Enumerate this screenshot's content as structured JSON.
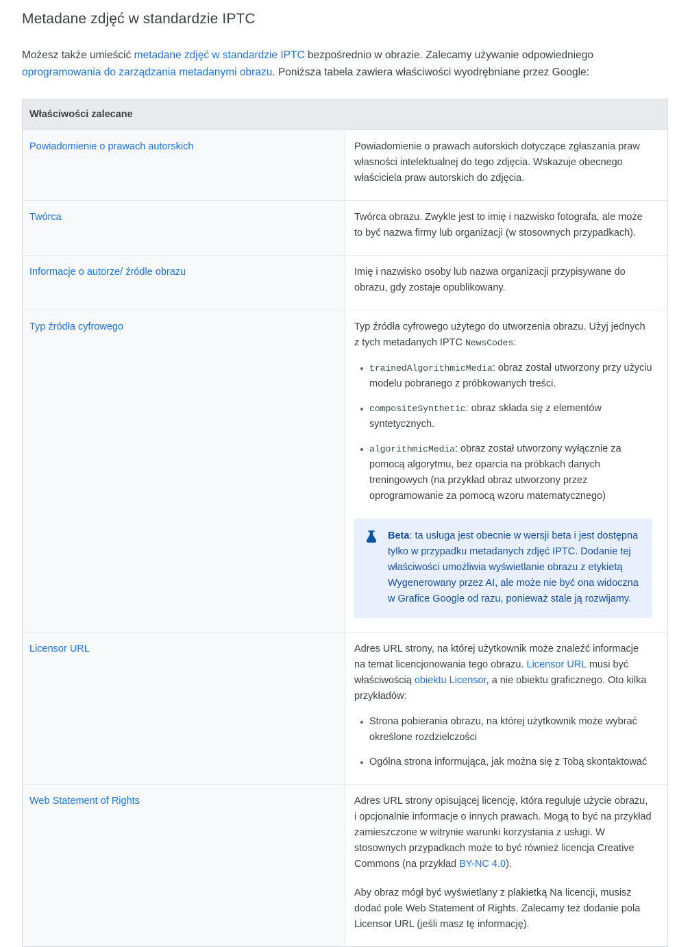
{
  "section": {
    "title": "Metadane zdjęć w standardzie IPTC",
    "intro": {
      "part1": "Możesz także umieścić ",
      "link1": "metadane zdjęć w standardzie IPTC",
      "part2": " bezpośrednio w obrazie. Zalecamy używanie odpowiedniego ",
      "link2": "oprogramowania do zarządzania metadanymi obrazu",
      "part3": ". Poniższa tabela zawiera właściwości wyodrębniane przez Google:"
    }
  },
  "table": {
    "header": "Właściwości zalecane",
    "rows": [
      {
        "name": "Powiadomienie o prawach autorskich",
        "desc": "Powiadomienie o prawach autorskich dotyczące zgłaszania praw własności intelektualnej do tego zdjęcia. Wskazuje obecnego właściciela praw autorskich do zdjęcia."
      },
      {
        "name": "Twórca",
        "desc": "Twórca obrazu. Zwykle jest to imię i nazwisko fotografa, ale może to być nazwa firmy lub organizacji (w stosownych przypadkach)."
      },
      {
        "name": "Informacje o autorze/ źródle obrazu",
        "desc": "Imię i nazwisko osoby lub nazwa organizacji przypisywane do obrazu, gdy zostaje opublikowany."
      },
      {
        "name": "Typ źródła cyfrowego",
        "desc_part1": "Typ źródła cyfrowego użytego do utworzenia obrazu. Użyj jednych z tych metadanych IPTC ",
        "desc_code": "NewsCodes",
        "desc_part2": ":",
        "bullets": [
          {
            "code": "trainedAlgorithmicMedia",
            "text": ": obraz został utworzony przy użyciu modelu pobranego z próbkowanych treści."
          },
          {
            "code": "compositeSynthetic",
            "text": ": obraz składa się z elementów syntetycznych."
          },
          {
            "code": "algorithmicMedia",
            "text": ": obraz został utworzony wyłącznie za pomocą algorytmu, bez oparcia na próbkach danych treningowych (na przykład obraz utworzony przez oprogramowanie za pomocą wzoru matematycznego)"
          }
        ],
        "callout": {
          "icon": "flask-icon",
          "label": "Beta",
          "text": ": ta usługa jest obecnie w wersji beta i jest dostępna tylko w przypadku metadanych zdjęć IPTC. Dodanie tej właściwości umożliwia wyświetlanie obrazu z etykietą Wygenerowany przez AI, ale może nie być ona widoczna w Grafice Google od razu, ponieważ stale ją rozwijamy."
        }
      },
      {
        "name": "Licensor URL",
        "desc_part1": "Adres URL strony, na której użytkownik może znaleźć informacje na temat licencjonowania tego obrazu. ",
        "desc_link1": "Licensor URL",
        "desc_part2": " musi być właściwością ",
        "desc_link2": "obiektu Licensor",
        "desc_part3": ", a nie obiektu graficznego. Oto kilka przykładów:",
        "bullets": [
          "Strona pobierania obrazu, na której użytkownik może wybrać określone rozdzielczości",
          "Ogólna strona informująca, jak można się z Tobą skontaktować"
        ]
      },
      {
        "name": "Web Statement of Rights",
        "desc_part1": "Adres URL strony opisującej licencję, która reguluje użycie obrazu, i opcjonalnie informacje o innych prawach. Mogą to być na przykład zamieszczone w witrynie warunki korzystania z usługi. W stosownych przypadkach może to być również licencja Creative Commons (na przykład ",
        "desc_link1": "BY-NC 4.0",
        "desc_part2": ").",
        "desc_para2": "Aby obraz mógł być wyświetlany z plakietką Na licencji, musisz dodać pole Web Statement of Rights. Zalecamy też dodanie pola Licensor URL (jeśli masz tę informację)."
      }
    ]
  },
  "colors": {
    "link": "#1a73e8",
    "text": "#3c4043",
    "header_bg": "#e8eaed",
    "name_cell_bg": "#f8f9fa",
    "callout_bg": "#e8f0fe",
    "callout_text": "#174ea6",
    "border": "#dadce0"
  }
}
